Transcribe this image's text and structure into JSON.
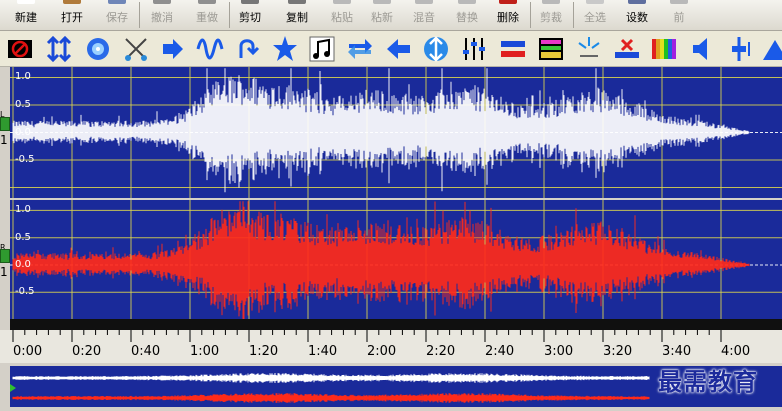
{
  "toolbar": {
    "buttons": [
      {
        "label": "新建",
        "enabled": true
      },
      {
        "label": "打开",
        "enabled": true
      },
      {
        "label": "保存",
        "enabled": false
      },
      {
        "label": "撤消",
        "enabled": false
      },
      {
        "label": "重做",
        "enabled": false
      },
      {
        "label": "剪切",
        "enabled": true
      },
      {
        "label": "复制",
        "enabled": true
      },
      {
        "label": "粘贴",
        "enabled": false
      },
      {
        "label": "粘新",
        "enabled": false
      },
      {
        "label": "混音",
        "enabled": false
      },
      {
        "label": "替换",
        "enabled": false
      },
      {
        "label": "删除",
        "enabled": true
      },
      {
        "label": "剪裁",
        "enabled": false
      },
      {
        "label": "全选",
        "enabled": false
      },
      {
        "label": "设数",
        "enabled": true
      },
      {
        "label": "前",
        "enabled": false
      }
    ]
  },
  "icons": [
    "stop-record-icon",
    "fit-vertical-icon",
    "cd-icon",
    "cross-cut-icon",
    "forward-arrow-icon",
    "sine-wave-icon",
    "undo-curve-icon",
    "star-effect-icon",
    "music-note-icon",
    "swap-arrows-icon",
    "left-arrow-icon",
    "vertical-zoom-icon",
    "equalizer-icon",
    "stereo-bars-icon",
    "spectrum-icon",
    "sparkle-icon",
    "mute-cross-icon",
    "color-bars-icon",
    "speaker-icon",
    "volume-slider-icon",
    "triangle-icon"
  ],
  "waveform": {
    "channels": [
      {
        "name": "L",
        "number": "1",
        "color": "#ffffff"
      },
      {
        "name": "R",
        "number": "1",
        "color": "#ff2a1a"
      }
    ],
    "y_labels": [
      "1.0",
      "0.5",
      "0.0",
      "-0.5"
    ],
    "background": "#1a2a9a",
    "grid_color": "#e0d84c"
  },
  "timeline": {
    "labels": [
      "0:00",
      "0:20",
      "0:40",
      "1:00",
      "1:20",
      "1:40",
      "2:00",
      "2:20",
      "2:40",
      "3:00",
      "3:20",
      "3:40",
      "4:00"
    ]
  },
  "watermark": "最需教育"
}
